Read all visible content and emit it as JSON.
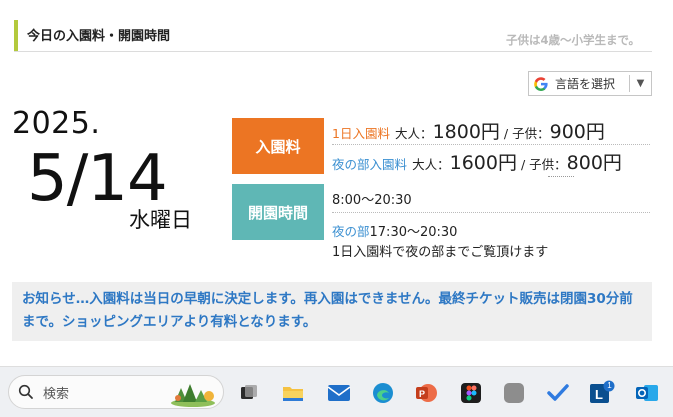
{
  "header": {
    "title": "今日の入園料・開園時間",
    "note": "子供は4歳〜小学生まで。"
  },
  "translate": {
    "label": "言語を選択",
    "caret": "▼"
  },
  "date": {
    "year": "2025.",
    "month_day": "5/14",
    "weekday": "水曜日"
  },
  "badges": {
    "fee": "入園料",
    "hours": "開園時間"
  },
  "fees": {
    "day": {
      "label": "1日入園料",
      "adult_label": "大人：",
      "adult_price": "1800円",
      "sep": " / ",
      "child_label": "子供：",
      "child_price": "900円"
    },
    "night": {
      "label": "夜の部入園料",
      "adult_label": "大人：",
      "adult_price": "1600円",
      "sep": " / ",
      "child_label": "子供：",
      "child_price": "800円"
    }
  },
  "hours": {
    "main": "8:00〜20:30",
    "night_label": "夜の部",
    "night_time": "17:30〜20:30",
    "note": "1日入園料で夜の部までご覧頂けます"
  },
  "notice": {
    "text": "お知らせ…入園料は当日の早朝に決定します。再入園はできません。最終チケット販売は閉園30分前まで。ショッピングエリアより有料となります。"
  },
  "taskbar": {
    "search_placeholder": "検索",
    "icons": [
      "task-view-icon",
      "file-explorer-icon",
      "mail-icon",
      "edge-icon",
      "powerpoint-icon",
      "figma-icon",
      "app-icon",
      "todo-icon",
      "linkedin-learning-icon",
      "outlook-icon"
    ],
    "badge_count": "1"
  },
  "colors": {
    "accent_green": "#b3c93d",
    "fee_orange": "#ec7523",
    "hours_teal": "#5fb7b5",
    "link_blue": "#3a8fd1",
    "notice_blue": "#2e78c4"
  }
}
